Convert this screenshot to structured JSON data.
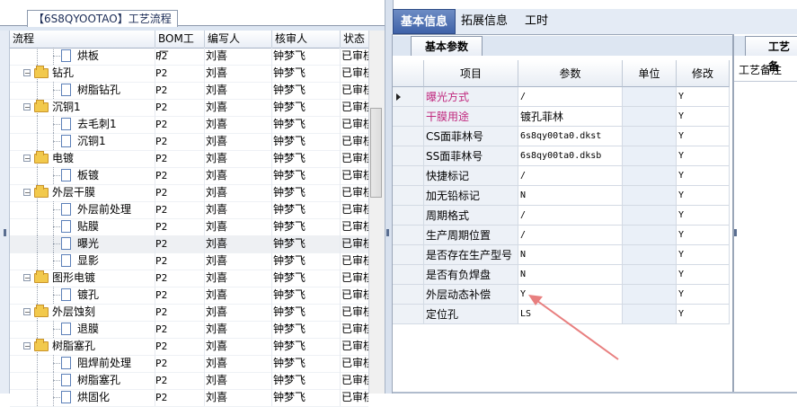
{
  "left": {
    "title": "【6S8QYOOTAO】工艺流程",
    "columns": [
      "流程",
      "BOM工厂",
      "编写人",
      "核审人",
      "状态"
    ],
    "rows": [
      {
        "name": "烘板",
        "bom": "P2",
        "writer": "刘喜",
        "reviewer": "钟梦飞",
        "status": "已审核",
        "type": "doc",
        "level": 2
      },
      {
        "name": "钻孔",
        "bom": "P2",
        "writer": "刘喜",
        "reviewer": "钟梦飞",
        "status": "已审核",
        "type": "folder",
        "level": 1
      },
      {
        "name": "树脂钻孔",
        "bom": "P2",
        "writer": "刘喜",
        "reviewer": "钟梦飞",
        "status": "已审核",
        "type": "doc",
        "level": 2
      },
      {
        "name": "沉铜1",
        "bom": "P2",
        "writer": "刘喜",
        "reviewer": "钟梦飞",
        "status": "已审核",
        "type": "folder",
        "level": 1
      },
      {
        "name": "去毛刺1",
        "bom": "P2",
        "writer": "刘喜",
        "reviewer": "钟梦飞",
        "status": "已审核",
        "type": "doc",
        "level": 2
      },
      {
        "name": "沉铜1",
        "bom": "P2",
        "writer": "刘喜",
        "reviewer": "钟梦飞",
        "status": "已审核",
        "type": "doc",
        "level": 2
      },
      {
        "name": "电镀",
        "bom": "P2",
        "writer": "刘喜",
        "reviewer": "钟梦飞",
        "status": "已审核",
        "type": "folder",
        "level": 1
      },
      {
        "name": "板镀",
        "bom": "P2",
        "writer": "刘喜",
        "reviewer": "钟梦飞",
        "status": "已审核",
        "type": "doc",
        "level": 2
      },
      {
        "name": "外层干膜",
        "bom": "P2",
        "writer": "刘喜",
        "reviewer": "钟梦飞",
        "status": "已审核",
        "type": "folder",
        "level": 1
      },
      {
        "name": "外层前处理",
        "bom": "P2",
        "writer": "刘喜",
        "reviewer": "钟梦飞",
        "status": "已审核",
        "type": "doc",
        "level": 2
      },
      {
        "name": "贴膜",
        "bom": "P2",
        "writer": "刘喜",
        "reviewer": "钟梦飞",
        "status": "已审核",
        "type": "doc",
        "level": 2
      },
      {
        "name": "曝光",
        "bom": "P2",
        "writer": "刘喜",
        "reviewer": "钟梦飞",
        "status": "已审核",
        "type": "doc",
        "level": 2,
        "selected": true
      },
      {
        "name": "显影",
        "bom": "P2",
        "writer": "刘喜",
        "reviewer": "钟梦飞",
        "status": "已审核",
        "type": "doc",
        "level": 2
      },
      {
        "name": "图形电镀",
        "bom": "P2",
        "writer": "刘喜",
        "reviewer": "钟梦飞",
        "status": "已审核",
        "type": "folder",
        "level": 1
      },
      {
        "name": "镀孔",
        "bom": "P2",
        "writer": "刘喜",
        "reviewer": "钟梦飞",
        "status": "已审核",
        "type": "doc",
        "level": 2
      },
      {
        "name": "外层蚀刻",
        "bom": "P2",
        "writer": "刘喜",
        "reviewer": "钟梦飞",
        "status": "已审核",
        "type": "folder",
        "level": 1
      },
      {
        "name": "退膜",
        "bom": "P2",
        "writer": "刘喜",
        "reviewer": "钟梦飞",
        "status": "已审核",
        "type": "doc",
        "level": 2
      },
      {
        "name": "树脂塞孔",
        "bom": "P2",
        "writer": "刘喜",
        "reviewer": "钟梦飞",
        "status": "已审核",
        "type": "folder",
        "level": 1
      },
      {
        "name": "阻焊前处理",
        "bom": "P2",
        "writer": "刘喜",
        "reviewer": "钟梦飞",
        "status": "已审核",
        "type": "doc",
        "level": 2
      },
      {
        "name": "树脂塞孔",
        "bom": "P2",
        "writer": "刘喜",
        "reviewer": "钟梦飞",
        "status": "已审核",
        "type": "doc",
        "level": 2
      },
      {
        "name": "烘固化",
        "bom": "P2",
        "writer": "刘喜",
        "reviewer": "钟梦飞",
        "status": "已审核",
        "type": "doc",
        "level": 2
      }
    ]
  },
  "tabs": [
    "基本信息",
    "拓展信息",
    "工时"
  ],
  "params": {
    "title": "基本参数",
    "columns": [
      "项目",
      "参数",
      "单位",
      "修改"
    ],
    "rows": [
      {
        "item": "曝光方式",
        "value": "/",
        "unit": "",
        "modify": "Y",
        "pink": true,
        "current": true
      },
      {
        "item": "干膜用途",
        "value": "镀孔菲林",
        "unit": "",
        "modify": "Y",
        "pink": true
      },
      {
        "item": "CS面菲林号",
        "value": "6s8qy00ta0.dkst",
        "unit": "",
        "modify": "Y"
      },
      {
        "item": "SS面菲林号",
        "value": "6s8qy00ta0.dksb",
        "unit": "",
        "modify": "Y"
      },
      {
        "item": "快捷标记",
        "value": "/",
        "unit": "",
        "modify": "Y"
      },
      {
        "item": "加无铅标记",
        "value": "N",
        "unit": "",
        "modify": "Y"
      },
      {
        "item": "周期格式",
        "value": "/",
        "unit": "",
        "modify": "Y"
      },
      {
        "item": "生产周期位置",
        "value": "/",
        "unit": "",
        "modify": "Y"
      },
      {
        "item": "是否存在生产型号",
        "value": "N",
        "unit": "",
        "modify": "Y"
      },
      {
        "item": "是否有负焊盘",
        "value": "N",
        "unit": "",
        "modify": "Y"
      },
      {
        "item": "外层动态补偿",
        "value": "Y",
        "unit": "",
        "modify": "Y"
      },
      {
        "item": "定位孔",
        "value": "LS",
        "unit": "",
        "modify": "Y"
      }
    ]
  },
  "right": {
    "title": "工艺备",
    "label": "工艺备注"
  },
  "annotation_color": "#e87f7f"
}
